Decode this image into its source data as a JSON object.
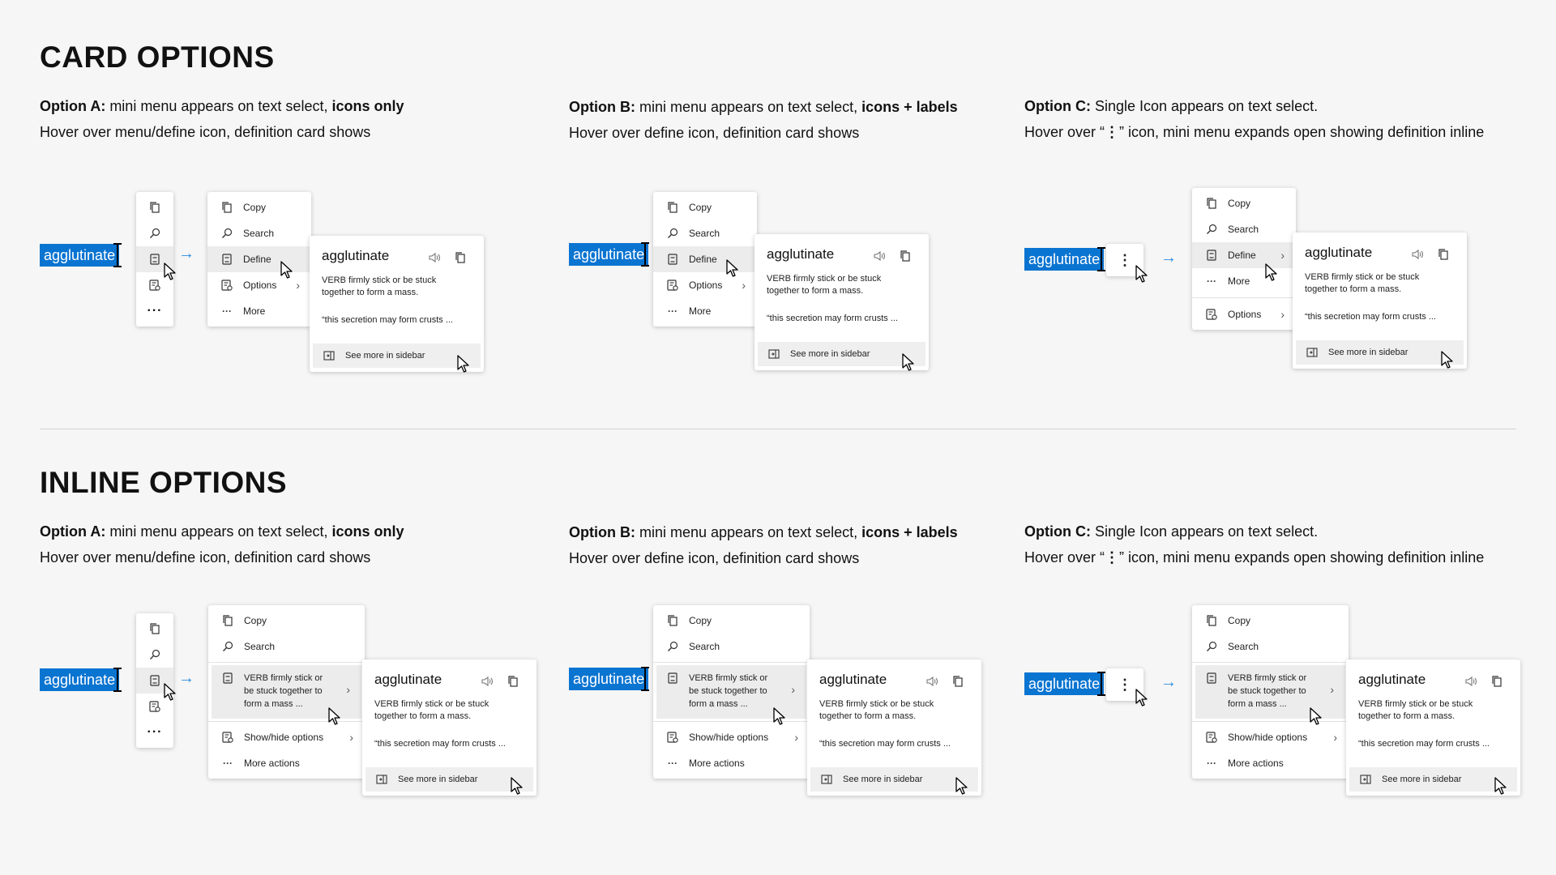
{
  "sections": {
    "card": {
      "heading": "CARD OPTIONS"
    },
    "inline": {
      "heading": "INLINE OPTIONS"
    }
  },
  "options": {
    "a": {
      "bold_prefix": "Option A:",
      "text": " mini menu appears on text select, ",
      "bold_suffix": "icons only",
      "line2": "Hover over menu/define icon, definition card shows"
    },
    "b": {
      "bold_prefix": "Option B:",
      "text": " mini menu appears on text select, ",
      "bold_suffix": "icons + labels",
      "line2": "Hover over define icon, definition card shows"
    },
    "c": {
      "bold_prefix": "Option C:",
      "text": " Single Icon appears on text select.",
      "line2_pre": "Hover over “",
      "line2_glyph": "⋮",
      "line2_post": "”  icon, mini menu expands open showing definition inline"
    }
  },
  "selected_word": "agglutinate",
  "menu": {
    "copy": "Copy",
    "search": "Search",
    "define": "Define",
    "options": "Options",
    "more": "More",
    "show_hide": "Show/hide options",
    "more_actions": "More actions",
    "inline_def": "VERB  firmly stick or be stuck together to form a mass ..."
  },
  "definition": {
    "word": "agglutinate",
    "definition": "VERB  firmly stick or be stuck together to form a mass.",
    "example": "“this secretion may form crusts  ...",
    "footer": "See more in sidebar"
  },
  "arrow_glyph": "→",
  "kebab_glyph": "⋮",
  "colors": {
    "selection": "#0a74d1",
    "arrow": "#2b8be0",
    "highlight": "#ececec"
  }
}
